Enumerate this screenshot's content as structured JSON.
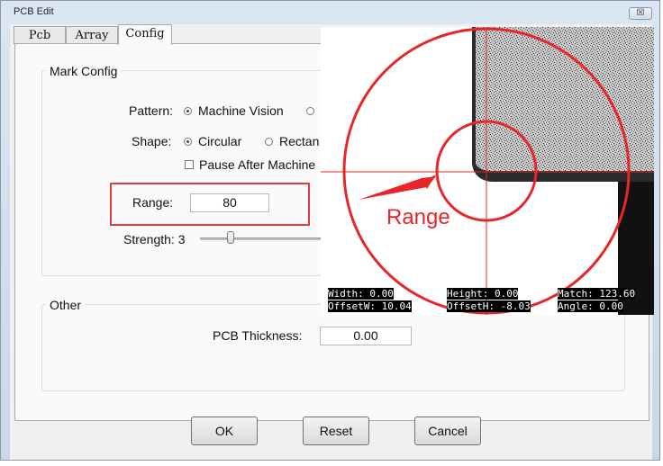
{
  "window": {
    "title": "PCB Edit",
    "close_glyph": "☒"
  },
  "tabs": [
    {
      "label": "Pcb"
    },
    {
      "label": "Array"
    },
    {
      "label": "Config"
    }
  ],
  "mark_config": {
    "group_label": "Mark Config",
    "pattern_label": "Pattern:",
    "pattern_options": [
      {
        "label": "Machine Vision",
        "selected": true
      },
      {
        "label": "",
        "selected": false
      }
    ],
    "shape_label": "Shape:",
    "shape_options": [
      {
        "label": "Circular",
        "selected": true
      },
      {
        "label": "Rectan",
        "selected": false
      }
    ],
    "pause_label": "Pause After Machine",
    "range_label": "Range:",
    "range_value": "80",
    "strength_label": "Strength: 3",
    "strength_level": 3
  },
  "other": {
    "group_label": "Other",
    "thickness_label": "PCB Thickness:",
    "thickness_value": "0.00"
  },
  "buttons": {
    "ok": "OK",
    "reset": "Reset",
    "cancel": "Cancel"
  },
  "camera": {
    "annotation": "Range",
    "width_label": "Width:",
    "width_value": "0.00",
    "height_label": "Height:",
    "height_value": "0.00",
    "match_label": "Match:",
    "match_value": "123.60",
    "offsetw_label": "OffsetW:",
    "offsetw_value": "10.04",
    "offseth_label": "OffsetH:",
    "offseth_value": "-8.03",
    "angle_label": "Angle:",
    "angle_value": "0.00",
    "annotation_color": "#e8262a"
  },
  "colors": {
    "highlight": "#e53b3b",
    "radio_dot": "#1f4e96"
  }
}
